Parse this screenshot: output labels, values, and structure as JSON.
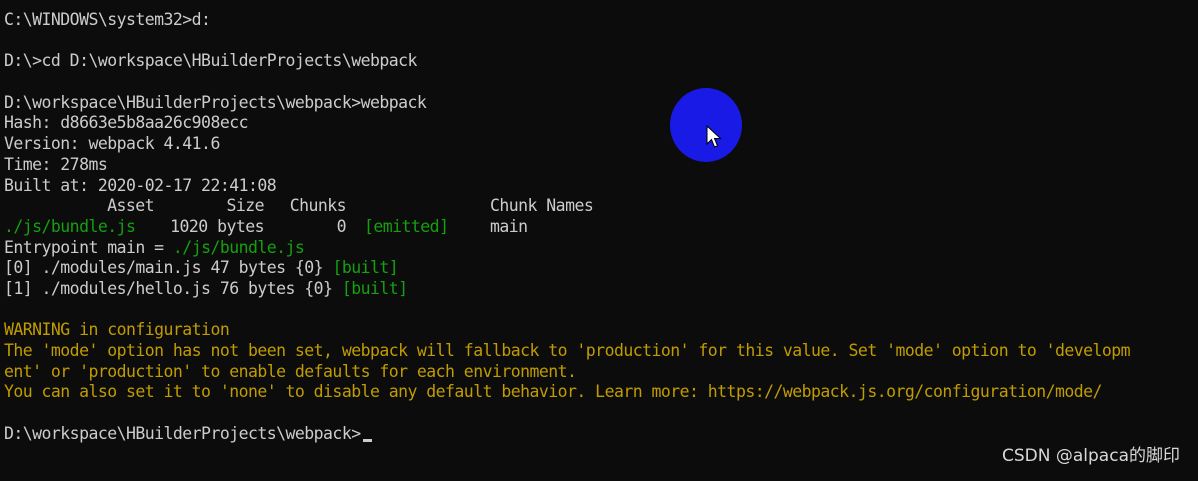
{
  "console": {
    "line1": "C:\\WINDOWS\\system32>d:",
    "line2": "D:\\>cd D:\\workspace\\HBuilderProjects\\webpack",
    "line3": "D:\\workspace\\HBuilderProjects\\webpack>webpack",
    "hash": "Hash: d8663e5b8aa26c908ecc",
    "version": "Version: webpack 4.41.6",
    "time": "Time: 278ms",
    "built_at": "Built at: 2020-02-17 22:41:08",
    "table_header": {
      "asset": "Asset",
      "size": "Size",
      "chunks": "Chunks",
      "chunk_names": "Chunk Names"
    },
    "table_row": {
      "asset": "./js/bundle.js",
      "size": "1020 bytes",
      "chunks": "0",
      "status": "[emitted]",
      "chunk_names": "main"
    },
    "entrypoint_prefix": "Entrypoint main = ",
    "entrypoint_file": "./js/bundle.js",
    "module0_prefix": "[0] ./modules/main.js 47 bytes {0} ",
    "module0_status": "[built]",
    "module1_prefix": "[1] ./modules/hello.js 76 bytes {0} ",
    "module1_status": "[built]",
    "warning_title": "WARNING in configuration",
    "warning_line1": "The 'mode' option has not been set, webpack will fallback to 'production' for this value. Set 'mode' option to 'developm",
    "warning_line2": "ent' or 'production' to enable defaults for each environment.",
    "warning_line3": "You can also set it to 'none' to disable any default behavior. Learn more: https://webpack.js.org/configuration/mode/",
    "prompt_final": "D:\\workspace\\HBuilderProjects\\webpack>"
  },
  "colors": {
    "background": "#0c0c0c",
    "text": "#cccccc",
    "green": "#13a10e",
    "warning": "#c19c00",
    "click_highlight": "#1a1ae6"
  },
  "icons": {
    "pointer": "mouse-pointer-icon"
  },
  "watermark": "CSDN @alpaca的脚印"
}
